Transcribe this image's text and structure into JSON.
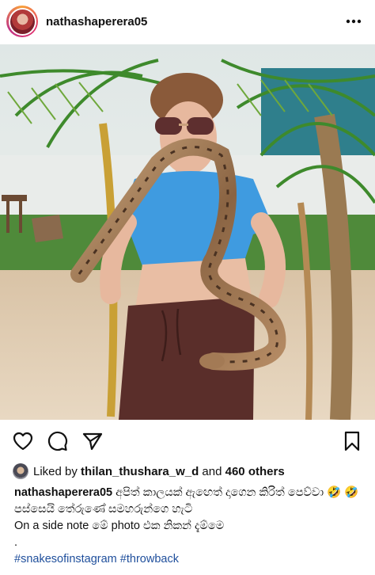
{
  "post": {
    "username": "nathashaperera05",
    "likes": {
      "prefix": "Liked by",
      "user": "thilan_thushara_w_d",
      "conj": "and",
      "others": "460 others"
    },
    "caption": {
      "username": "nathashaperera05",
      "line1": "අපිත් කාලයක් ඇඟෙත් දාගෙන කිරිත් පෙව්වා 🤣 🤣",
      "line2": "පස්සෙයි තේරුණේ සමහරුන්ගෙ හැටි",
      "line3": "On a side note මේ photo එක නිකන් දැම්මෙ",
      "line4": ".",
      "hashtags": [
        "#snakesofinstagram",
        "#throwback"
      ]
    }
  },
  "icons": {
    "more": "more-options-icon",
    "like": "heart-icon",
    "comment": "comment-icon",
    "share": "share-icon",
    "save": "bookmark-icon"
  },
  "colors": {
    "hashtag": "#1f4f9c",
    "shirt": "#3f9be0",
    "pants": "#5a2e2a"
  }
}
